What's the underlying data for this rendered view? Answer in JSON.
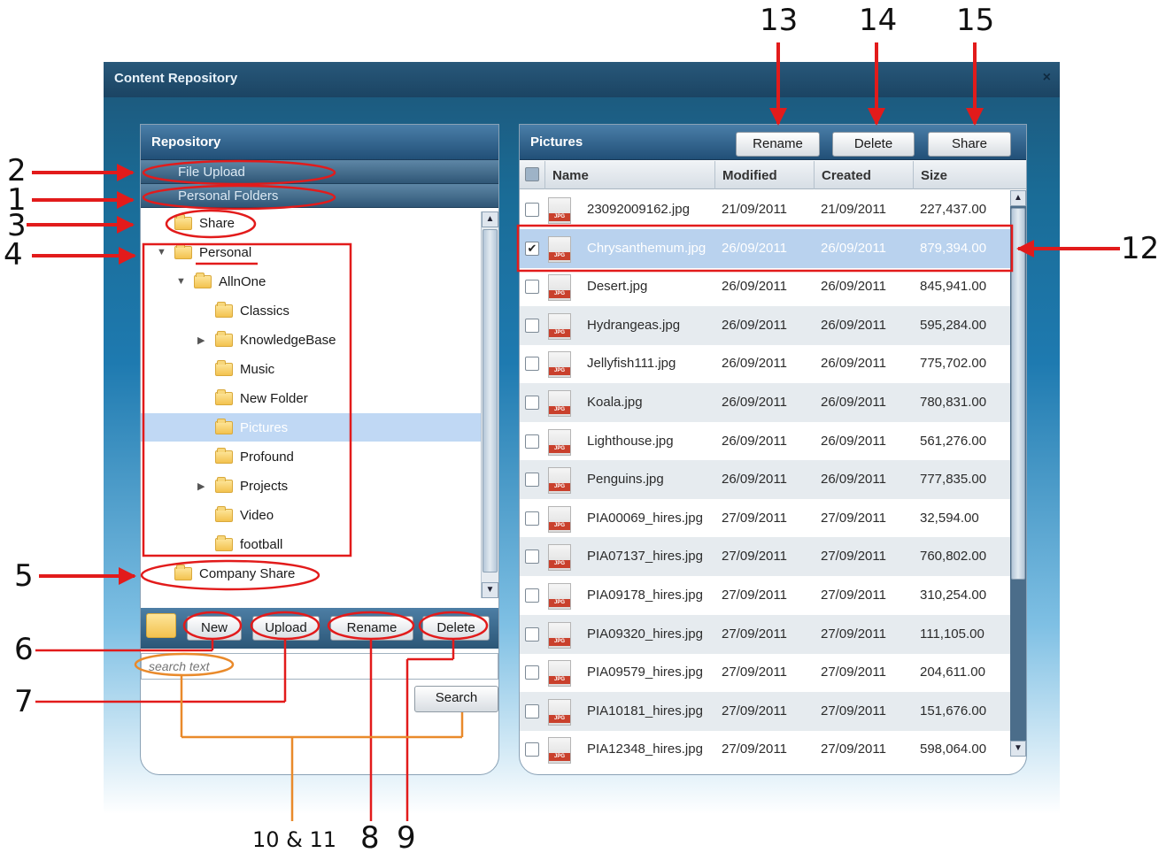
{
  "window": {
    "title": "Content Repository",
    "close_glyph": "×"
  },
  "left": {
    "header": "Repository",
    "file_upload": "File Upload",
    "personal_folders": "Personal Folders",
    "tree": [
      {
        "label": "Share",
        "depth": 0,
        "arrow": ""
      },
      {
        "label": "Personal",
        "depth": 0,
        "arrow": "▼"
      },
      {
        "label": "AllnOne",
        "depth": 1,
        "arrow": "▼"
      },
      {
        "label": "Classics",
        "depth": 2,
        "arrow": ""
      },
      {
        "label": "KnowledgeBase",
        "depth": 2,
        "arrow": "▶"
      },
      {
        "label": "Music",
        "depth": 2,
        "arrow": ""
      },
      {
        "label": "New Folder",
        "depth": 2,
        "arrow": ""
      },
      {
        "label": "Pictures",
        "depth": 2,
        "arrow": "",
        "selected": true
      },
      {
        "label": "Profound",
        "depth": 2,
        "arrow": ""
      },
      {
        "label": "Projects",
        "depth": 2,
        "arrow": "▶"
      },
      {
        "label": "Video",
        "depth": 2,
        "arrow": ""
      },
      {
        "label": "football",
        "depth": 2,
        "arrow": ""
      },
      {
        "label": "Company Share",
        "depth": 0,
        "arrow": ""
      }
    ],
    "buttons": {
      "new": "New",
      "upload": "Upload",
      "rename": "Rename",
      "delete": "Delete"
    },
    "search_placeholder": "search text",
    "search_button": "Search"
  },
  "right": {
    "header": "Pictures",
    "buttons": {
      "rename": "Rename",
      "delete": "Delete",
      "share": "Share"
    },
    "columns": [
      "Name",
      "Modified",
      "Created",
      "Size"
    ],
    "rows": [
      {
        "name": "23092009162.jpg",
        "modified": "21/09/2011",
        "created": "21/09/2011",
        "size": "227,437.00",
        "checked": false
      },
      {
        "name": "Chrysanthemum.jpg",
        "modified": "26/09/2011",
        "created": "26/09/2011",
        "size": "879,394.00",
        "checked": true
      },
      {
        "name": "Desert.jpg",
        "modified": "26/09/2011",
        "created": "26/09/2011",
        "size": "845,941.00",
        "checked": false
      },
      {
        "name": "Hydrangeas.jpg",
        "modified": "26/09/2011",
        "created": "26/09/2011",
        "size": "595,284.00",
        "checked": false
      },
      {
        "name": "Jellyfish111.jpg",
        "modified": "26/09/2011",
        "created": "26/09/2011",
        "size": "775,702.00",
        "checked": false
      },
      {
        "name": "Koala.jpg",
        "modified": "26/09/2011",
        "created": "26/09/2011",
        "size": "780,831.00",
        "checked": false
      },
      {
        "name": "Lighthouse.jpg",
        "modified": "26/09/2011",
        "created": "26/09/2011",
        "size": "561,276.00",
        "checked": false
      },
      {
        "name": "Penguins.jpg",
        "modified": "26/09/2011",
        "created": "26/09/2011",
        "size": "777,835.00",
        "checked": false
      },
      {
        "name": "PIA00069_hires.jpg",
        "modified": "27/09/2011",
        "created": "27/09/2011",
        "size": "32,594.00",
        "checked": false
      },
      {
        "name": "PIA07137_hires.jpg",
        "modified": "27/09/2011",
        "created": "27/09/2011",
        "size": "760,802.00",
        "checked": false
      },
      {
        "name": "PIA09178_hires.jpg",
        "modified": "27/09/2011",
        "created": "27/09/2011",
        "size": "310,254.00",
        "checked": false
      },
      {
        "name": "PIA09320_hires.jpg",
        "modified": "27/09/2011",
        "created": "27/09/2011",
        "size": "111,105.00",
        "checked": false
      },
      {
        "name": "PIA09579_hires.jpg",
        "modified": "27/09/2011",
        "created": "27/09/2011",
        "size": "204,611.00",
        "checked": false
      },
      {
        "name": "PIA10181_hires.jpg",
        "modified": "27/09/2011",
        "created": "27/09/2011",
        "size": "151,676.00",
        "checked": false
      },
      {
        "name": "PIA12348_hires.jpg",
        "modified": "27/09/2011",
        "created": "27/09/2011",
        "size": "598,064.00",
        "checked": false
      }
    ]
  },
  "annotations": {
    "n1": "1",
    "n2": "2",
    "n3": "3",
    "n4": "4",
    "n5": "5",
    "n6": "6",
    "n7": "7",
    "n8": "8",
    "n9": "9",
    "n10_11": "10 & 11",
    "n12": "12",
    "n13": "13",
    "n14": "14",
    "n15": "15"
  },
  "colors": {
    "annotation": "#e21b1b",
    "callout": "#e98a2b",
    "selection": "#b9d2ee"
  }
}
